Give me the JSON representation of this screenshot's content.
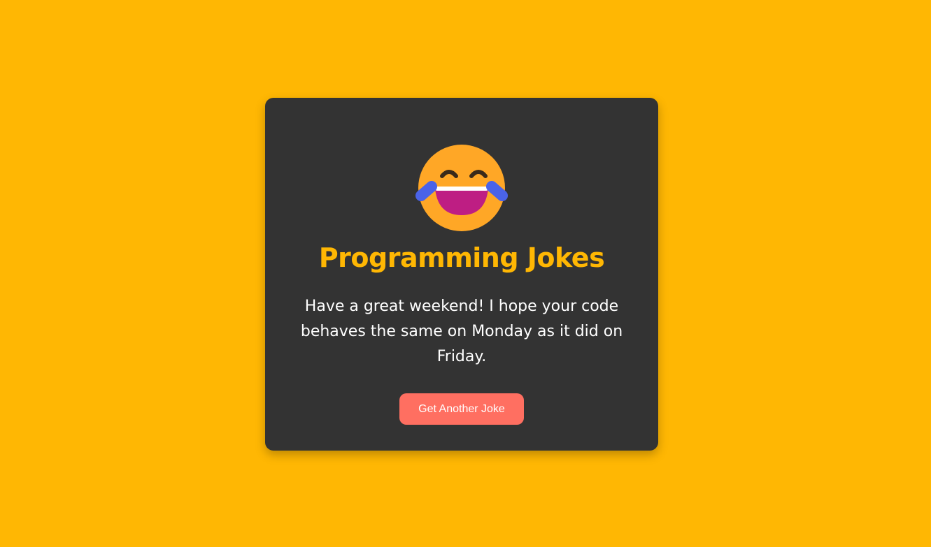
{
  "colors": {
    "background": "#FFB703",
    "card": "#333333",
    "title": "#FFB703",
    "button": "#FF6F61",
    "text": "#FFFFFF"
  },
  "card": {
    "icon": "laughing-with-tears-emoji-icon",
    "title": "Programming Jokes",
    "joke": "Have a great weekend! I hope your code behaves the same on Monday as it did on Friday.",
    "button_label": "Get Another Joke"
  }
}
